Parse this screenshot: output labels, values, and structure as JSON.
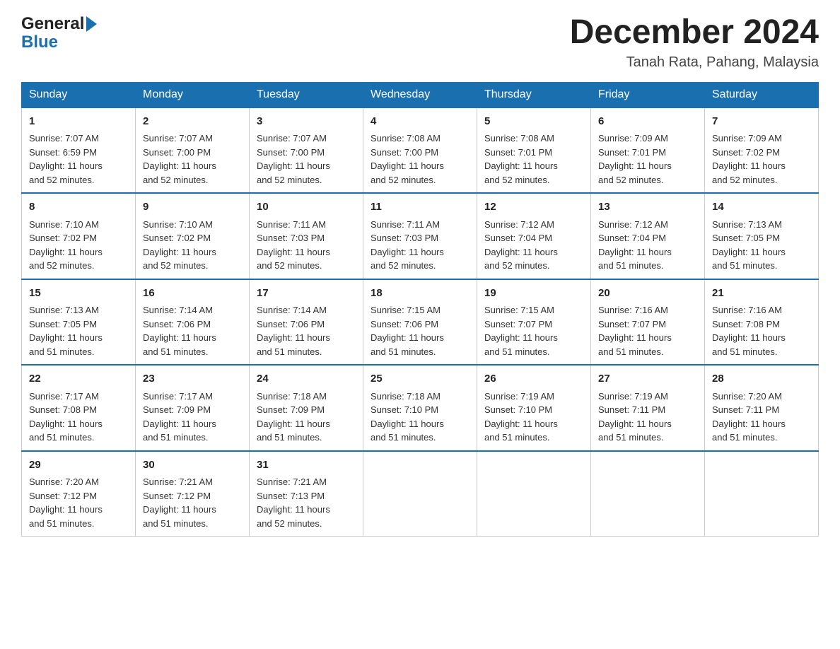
{
  "header": {
    "logo_general": "General",
    "logo_blue": "Blue",
    "month_title": "December 2024",
    "location": "Tanah Rata, Pahang, Malaysia"
  },
  "days_of_week": [
    "Sunday",
    "Monday",
    "Tuesday",
    "Wednesday",
    "Thursday",
    "Friday",
    "Saturday"
  ],
  "weeks": [
    [
      {
        "day": "1",
        "info": "Sunrise: 7:07 AM\nSunset: 6:59 PM\nDaylight: 11 hours\nand 52 minutes."
      },
      {
        "day": "2",
        "info": "Sunrise: 7:07 AM\nSunset: 7:00 PM\nDaylight: 11 hours\nand 52 minutes."
      },
      {
        "day": "3",
        "info": "Sunrise: 7:07 AM\nSunset: 7:00 PM\nDaylight: 11 hours\nand 52 minutes."
      },
      {
        "day": "4",
        "info": "Sunrise: 7:08 AM\nSunset: 7:00 PM\nDaylight: 11 hours\nand 52 minutes."
      },
      {
        "day": "5",
        "info": "Sunrise: 7:08 AM\nSunset: 7:01 PM\nDaylight: 11 hours\nand 52 minutes."
      },
      {
        "day": "6",
        "info": "Sunrise: 7:09 AM\nSunset: 7:01 PM\nDaylight: 11 hours\nand 52 minutes."
      },
      {
        "day": "7",
        "info": "Sunrise: 7:09 AM\nSunset: 7:02 PM\nDaylight: 11 hours\nand 52 minutes."
      }
    ],
    [
      {
        "day": "8",
        "info": "Sunrise: 7:10 AM\nSunset: 7:02 PM\nDaylight: 11 hours\nand 52 minutes."
      },
      {
        "day": "9",
        "info": "Sunrise: 7:10 AM\nSunset: 7:02 PM\nDaylight: 11 hours\nand 52 minutes."
      },
      {
        "day": "10",
        "info": "Sunrise: 7:11 AM\nSunset: 7:03 PM\nDaylight: 11 hours\nand 52 minutes."
      },
      {
        "day": "11",
        "info": "Sunrise: 7:11 AM\nSunset: 7:03 PM\nDaylight: 11 hours\nand 52 minutes."
      },
      {
        "day": "12",
        "info": "Sunrise: 7:12 AM\nSunset: 7:04 PM\nDaylight: 11 hours\nand 52 minutes."
      },
      {
        "day": "13",
        "info": "Sunrise: 7:12 AM\nSunset: 7:04 PM\nDaylight: 11 hours\nand 51 minutes."
      },
      {
        "day": "14",
        "info": "Sunrise: 7:13 AM\nSunset: 7:05 PM\nDaylight: 11 hours\nand 51 minutes."
      }
    ],
    [
      {
        "day": "15",
        "info": "Sunrise: 7:13 AM\nSunset: 7:05 PM\nDaylight: 11 hours\nand 51 minutes."
      },
      {
        "day": "16",
        "info": "Sunrise: 7:14 AM\nSunset: 7:06 PM\nDaylight: 11 hours\nand 51 minutes."
      },
      {
        "day": "17",
        "info": "Sunrise: 7:14 AM\nSunset: 7:06 PM\nDaylight: 11 hours\nand 51 minutes."
      },
      {
        "day": "18",
        "info": "Sunrise: 7:15 AM\nSunset: 7:06 PM\nDaylight: 11 hours\nand 51 minutes."
      },
      {
        "day": "19",
        "info": "Sunrise: 7:15 AM\nSunset: 7:07 PM\nDaylight: 11 hours\nand 51 minutes."
      },
      {
        "day": "20",
        "info": "Sunrise: 7:16 AM\nSunset: 7:07 PM\nDaylight: 11 hours\nand 51 minutes."
      },
      {
        "day": "21",
        "info": "Sunrise: 7:16 AM\nSunset: 7:08 PM\nDaylight: 11 hours\nand 51 minutes."
      }
    ],
    [
      {
        "day": "22",
        "info": "Sunrise: 7:17 AM\nSunset: 7:08 PM\nDaylight: 11 hours\nand 51 minutes."
      },
      {
        "day": "23",
        "info": "Sunrise: 7:17 AM\nSunset: 7:09 PM\nDaylight: 11 hours\nand 51 minutes."
      },
      {
        "day": "24",
        "info": "Sunrise: 7:18 AM\nSunset: 7:09 PM\nDaylight: 11 hours\nand 51 minutes."
      },
      {
        "day": "25",
        "info": "Sunrise: 7:18 AM\nSunset: 7:10 PM\nDaylight: 11 hours\nand 51 minutes."
      },
      {
        "day": "26",
        "info": "Sunrise: 7:19 AM\nSunset: 7:10 PM\nDaylight: 11 hours\nand 51 minutes."
      },
      {
        "day": "27",
        "info": "Sunrise: 7:19 AM\nSunset: 7:11 PM\nDaylight: 11 hours\nand 51 minutes."
      },
      {
        "day": "28",
        "info": "Sunrise: 7:20 AM\nSunset: 7:11 PM\nDaylight: 11 hours\nand 51 minutes."
      }
    ],
    [
      {
        "day": "29",
        "info": "Sunrise: 7:20 AM\nSunset: 7:12 PM\nDaylight: 11 hours\nand 51 minutes."
      },
      {
        "day": "30",
        "info": "Sunrise: 7:21 AM\nSunset: 7:12 PM\nDaylight: 11 hours\nand 51 minutes."
      },
      {
        "day": "31",
        "info": "Sunrise: 7:21 AM\nSunset: 7:13 PM\nDaylight: 11 hours\nand 52 minutes."
      },
      {
        "day": "",
        "info": ""
      },
      {
        "day": "",
        "info": ""
      },
      {
        "day": "",
        "info": ""
      },
      {
        "day": "",
        "info": ""
      }
    ]
  ]
}
